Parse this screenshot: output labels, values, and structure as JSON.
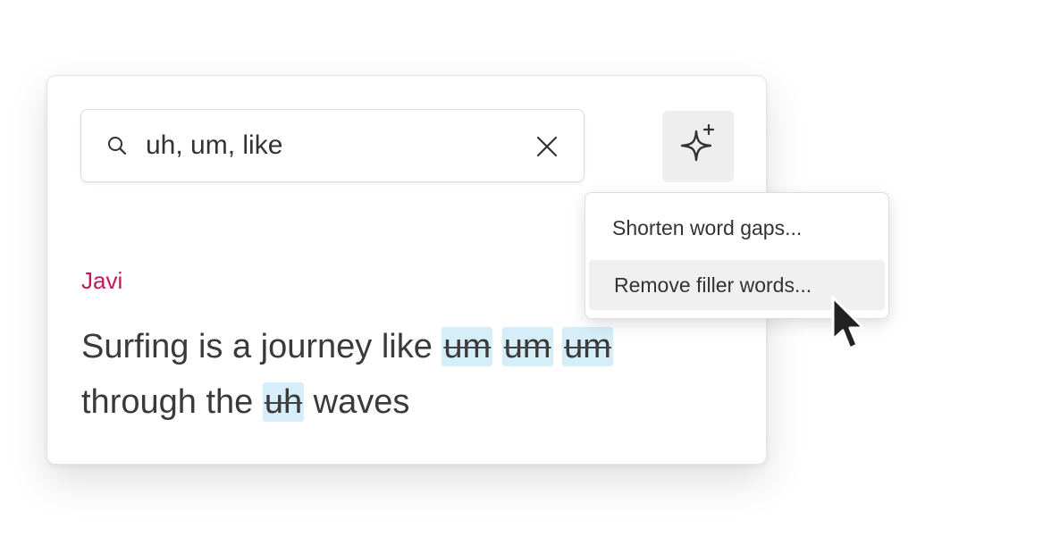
{
  "search": {
    "value": "uh, um, like",
    "icon": "search-icon",
    "clear_icon": "close-icon"
  },
  "ai_button": {
    "icon": "sparkle-icon"
  },
  "transcript": {
    "speaker": "Javi",
    "speaker_color": "#c2185b",
    "highlight_color": "#d6eef9",
    "line1_text": "Surfing is a journey like ",
    "line1_fillers": [
      "um",
      "um",
      "um"
    ],
    "line2_start": "through the ",
    "line2_filler": "uh",
    "line2_end": " waves"
  },
  "menu": {
    "items": [
      {
        "label": "Shorten word gaps..."
      },
      {
        "label": "Remove filler words..."
      }
    ],
    "hovered_index": 1
  }
}
